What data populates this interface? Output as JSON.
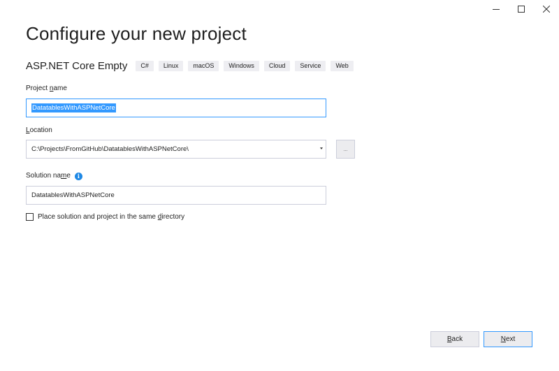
{
  "window": {
    "minimize_icon": "minimize-icon",
    "maximize_icon": "maximize-icon",
    "close_icon": "close-icon"
  },
  "title": "Configure your new project",
  "template": {
    "name": "ASP.NET Core Empty",
    "tags": [
      "C#",
      "Linux",
      "macOS",
      "Windows",
      "Cloud",
      "Service",
      "Web"
    ]
  },
  "project_name": {
    "label_pre": "Project ",
    "label_accel": "n",
    "label_post": "ame",
    "value": "DatatablesWithASPNetCore"
  },
  "location": {
    "label_pre": "",
    "label_accel": "L",
    "label_post": "ocation",
    "value": "C:\\Projects\\FromGitHub\\DatatablesWithASPNetCore\\",
    "browse_label": "..."
  },
  "solution_name": {
    "label_pre": "Solution na",
    "label_accel": "m",
    "label_post": "e",
    "info_glyph": "i",
    "value": "DatatablesWithASPNetCore"
  },
  "same_directory": {
    "checked": false,
    "label_pre": "Place solution and project in the same ",
    "label_accel": "d",
    "label_post": "irectory"
  },
  "footer": {
    "back_accel": "B",
    "back_post": "ack",
    "next_accel": "N",
    "next_post": "ext"
  },
  "colors": {
    "accent": "#3399ff",
    "info": "#1e88e5",
    "tag_bg": "#eeeef2"
  }
}
